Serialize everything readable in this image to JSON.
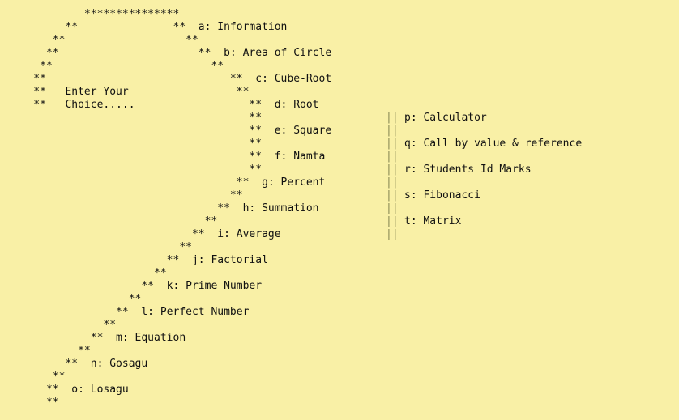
{
  "colors": {
    "background": "#f9f0a6",
    "text": "#111111",
    "divider_bars": "#8a8a55"
  },
  "lines": [
    "            ***************",
    "         **               **  a: Information",
    "       **                   **",
    "      **                      **  b: Area of Circle",
    "     **                         **",
    "    **                             **  c: Cube-Root",
    "    **   Enter Your                 **",
    "    **   Choice.....                  **  d: Root",
    "                                      **",
    "                                      **  e: Square",
    "                                      **",
    "                                      **  f: Namta",
    "                                      **",
    "                                    **  g: Percent",
    "                                   **",
    "                                 **  h: Summation",
    "                               **",
    "                             **  i: Average",
    "                           **",
    "                         **  j: Factorial",
    "                       **",
    "                     **  k: Prime Number",
    "                   **",
    "                 **  l: Perfect Number",
    "               **",
    "             **  m: Equation",
    "           **",
    "         **  n: Gosagu",
    "       **",
    "      **  o: Losagu",
    "      **"
  ],
  "right_menu": {
    "separator": "||",
    "items": [
      "p: Calculator",
      "q: Call by value & reference",
      "r: Students Id Marks",
      "s: Fibonacci",
      "t: Matrix"
    ]
  }
}
